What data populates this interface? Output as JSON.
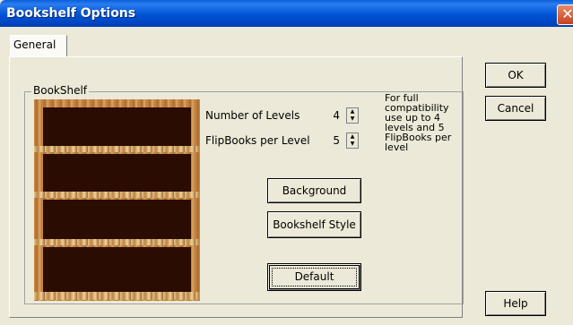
{
  "window": {
    "title": "Bookshelf Options",
    "close_glyph": "✕"
  },
  "tabs": [
    {
      "label": "General"
    }
  ],
  "group": {
    "label": "BookShelf"
  },
  "fields": {
    "levels_label": "Number of Levels",
    "levels_value": "4",
    "flipbooks_label": "FlipBooks per Level",
    "flipbooks_value": "5"
  },
  "buttons": {
    "background": "Background",
    "style": "Bookshelf Style",
    "default": "Default",
    "ok": "OK",
    "cancel": "Cancel",
    "help": "Help"
  },
  "note": "For full compatibility use up to 4 levels and 5 FlipBooks per level",
  "icons": {
    "spin_up": "▲",
    "spin_down": "▼",
    "close": "close-icon"
  },
  "colors": {
    "titlebar": "#0053d4",
    "shelf_wood": "#b77a3b",
    "shelf_back": "#2a0c02",
    "dialog_bg": "#ece9d8"
  }
}
